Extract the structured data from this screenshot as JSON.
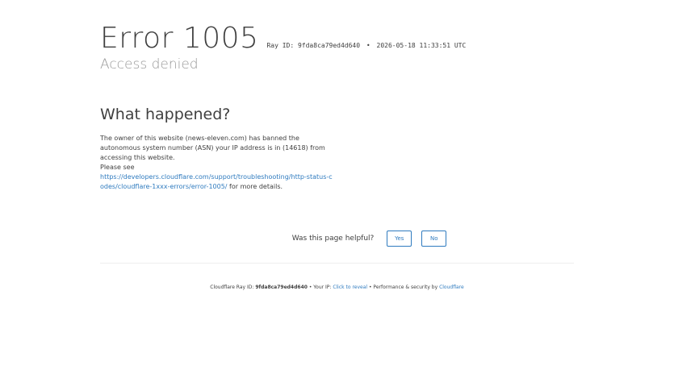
{
  "header": {
    "error_title": "Error 1005",
    "ray_label": "Ray ID: 9fda8ca79ed4d640",
    "bullet": "•",
    "timestamp": "2026-05-18 11:33:51 UTC",
    "subtitle": "Access denied"
  },
  "what_happened": {
    "heading": "What happened?",
    "paragraph": "The owner of this website (news-eleven.com) has banned the autonomous system number (ASN) your IP address is in (14618) from accessing this website.",
    "please_see": "Please see",
    "link": "https://developers.cloudflare.com/support/troubleshooting/http-status-codes/cloudflare-1xxx-errors/error-1005/",
    "after_link": " for more details."
  },
  "feedback": {
    "question": "Was this page helpful?",
    "yes_label": "Yes",
    "no_label": "No"
  },
  "footer": {
    "ray_prefix": "Cloudflare Ray ID: ",
    "ray_id": "9fda8ca79ed4d640",
    "sep1": " • Your IP: ",
    "reveal": "Click to reveal",
    "sep2": " • Performance & security by ",
    "cloudflare": "Cloudflare"
  },
  "colors": {
    "link": "#2f7bbf",
    "text": "#404040",
    "muted": "#999999"
  }
}
